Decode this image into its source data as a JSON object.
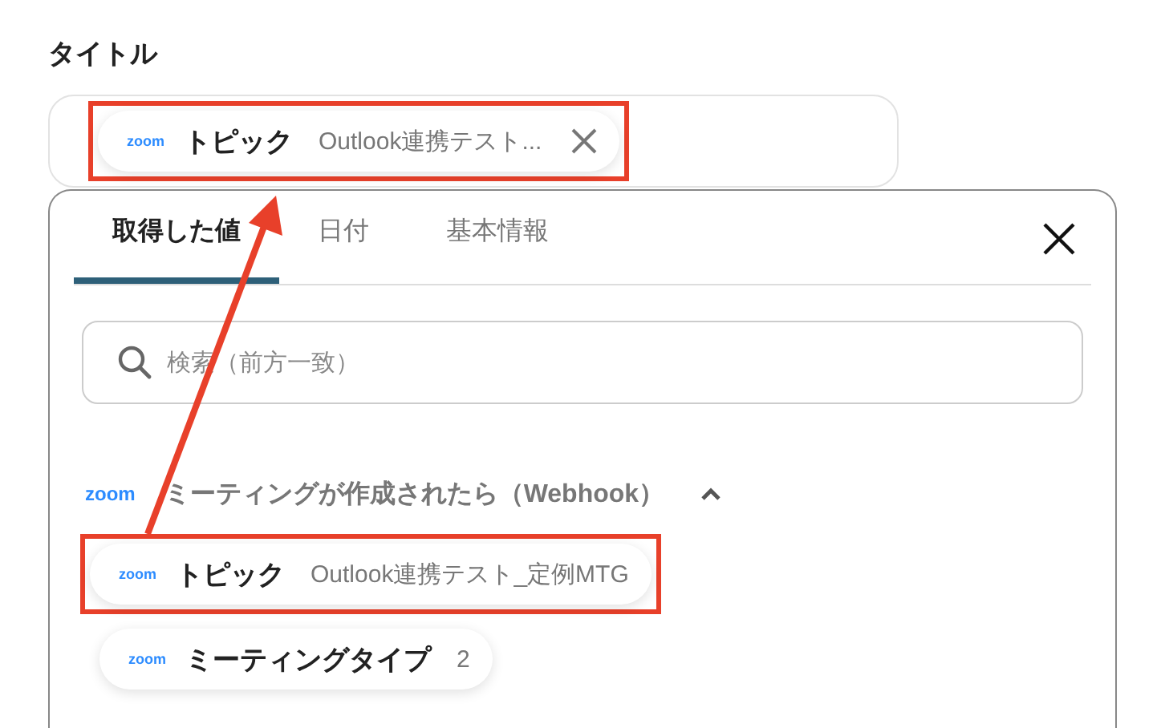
{
  "field": {
    "label": "タイトル",
    "token": {
      "logo": "zoom",
      "name": "トピック",
      "value": "Outlook連携テスト...",
      "highlighted": true
    }
  },
  "panel": {
    "tabs": [
      {
        "label": "取得した値",
        "selected": true
      },
      {
        "label": "日付",
        "selected": false
      },
      {
        "label": "基本情報",
        "selected": false
      }
    ],
    "search": {
      "placeholder": "検索（前方一致）"
    },
    "group": {
      "logo": "zoom",
      "title": "ミーティングが作成されたら（Webhook）",
      "expanded": true,
      "items": [
        {
          "logo": "zoom",
          "name": "トピック",
          "value": "Outlook連携テスト_定例MTG",
          "highlighted": true
        },
        {
          "logo": "zoom",
          "name": "ミーティングタイプ",
          "value": "2",
          "highlighted": false
        }
      ]
    }
  }
}
